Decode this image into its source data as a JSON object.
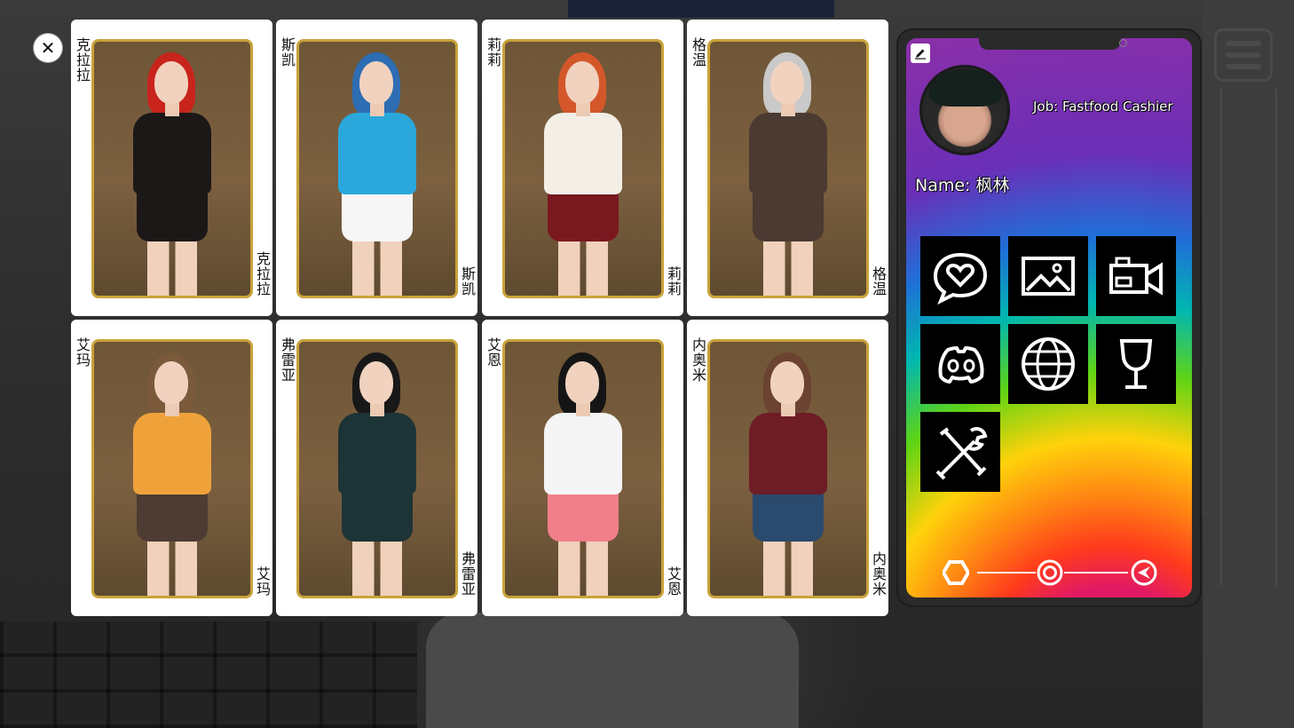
{
  "characters": [
    {
      "name": "克拉拉",
      "hair": "#c8241c",
      "top": "#1c1818",
      "bottom": "#1c1818"
    },
    {
      "name": "斯凯",
      "hair": "#2d6db3",
      "top": "#2aa8dc",
      "bottom": "#f6f6f6"
    },
    {
      "name": "莉莉",
      "hair": "#d4572a",
      "top": "#f3eee6",
      "bottom": "#7a1820"
    },
    {
      "name": "格温",
      "hair": "#c9c9c9",
      "top": "#4b3a32",
      "bottom": "#4b3a32"
    },
    {
      "name": "艾玛",
      "hair": "#7a5a3a",
      "top": "#f0a23a",
      "bottom": "#4d3c33"
    },
    {
      "name": "弗雷亚",
      "hair": "#181818",
      "top": "#1d3437",
      "bottom": "#1d3437"
    },
    {
      "name": "艾恩",
      "hair": "#151515",
      "top": "#f4f4f4",
      "bottom": "#f07f8a"
    },
    {
      "name": "内奥米",
      "hair": "#6b4330",
      "top": "#6e1c25",
      "bottom": "#2a4a6e"
    }
  ],
  "phone": {
    "job": "Job: Fastfood Cashier",
    "name": "Name: 枫林",
    "apps": [
      {
        "icon": "chat-heart-icon"
      },
      {
        "icon": "gallery-icon"
      },
      {
        "icon": "video-camera-icon"
      },
      {
        "icon": "discord-icon"
      },
      {
        "icon": "globe-icon"
      },
      {
        "icon": "trophy-icon"
      },
      {
        "icon": "tools-icon"
      }
    ],
    "nav": [
      {
        "icon": "hexagon-icon"
      },
      {
        "icon": "home-circle-icon"
      },
      {
        "icon": "back-arrow-icon"
      }
    ]
  },
  "colors": {
    "card_border": "#c9a33a",
    "app_tile": "#000000"
  }
}
